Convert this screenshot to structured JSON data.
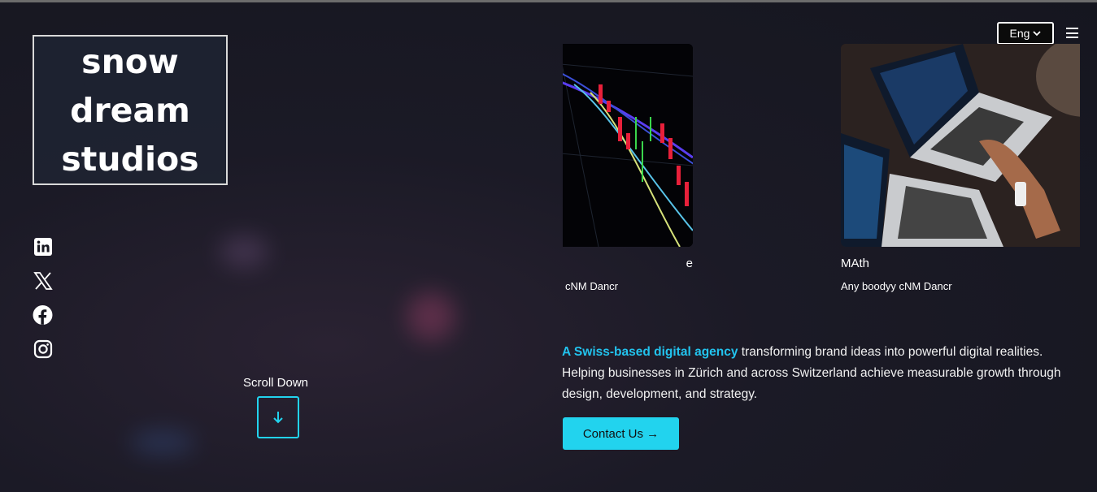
{
  "brand": {
    "lines": [
      "snow",
      "dream",
      "studios"
    ]
  },
  "header": {
    "language": "Eng"
  },
  "social": [
    "linkedin-icon",
    "x-icon",
    "facebook-icon",
    "instagram-icon"
  ],
  "scroll": {
    "label": "Scroll Down"
  },
  "cards": [
    {
      "title": "e",
      "subtitle": "cNM Dancr",
      "image": "stock-chart-photo"
    },
    {
      "title": "MAth",
      "subtitle": "Any boodyy cNM Dancr",
      "image": "laptops-photo"
    }
  ],
  "intro": {
    "highlight": "A Swiss-based digital agency",
    "rest": " transforming brand ideas into powerful digital realities. Helping businesses in Zürich and across Switzerland achieve measurable growth through design, development, and strategy."
  },
  "cta": {
    "label": "Contact Us →"
  },
  "colors": {
    "accent": "#22d3ee",
    "background": "#16161f"
  }
}
